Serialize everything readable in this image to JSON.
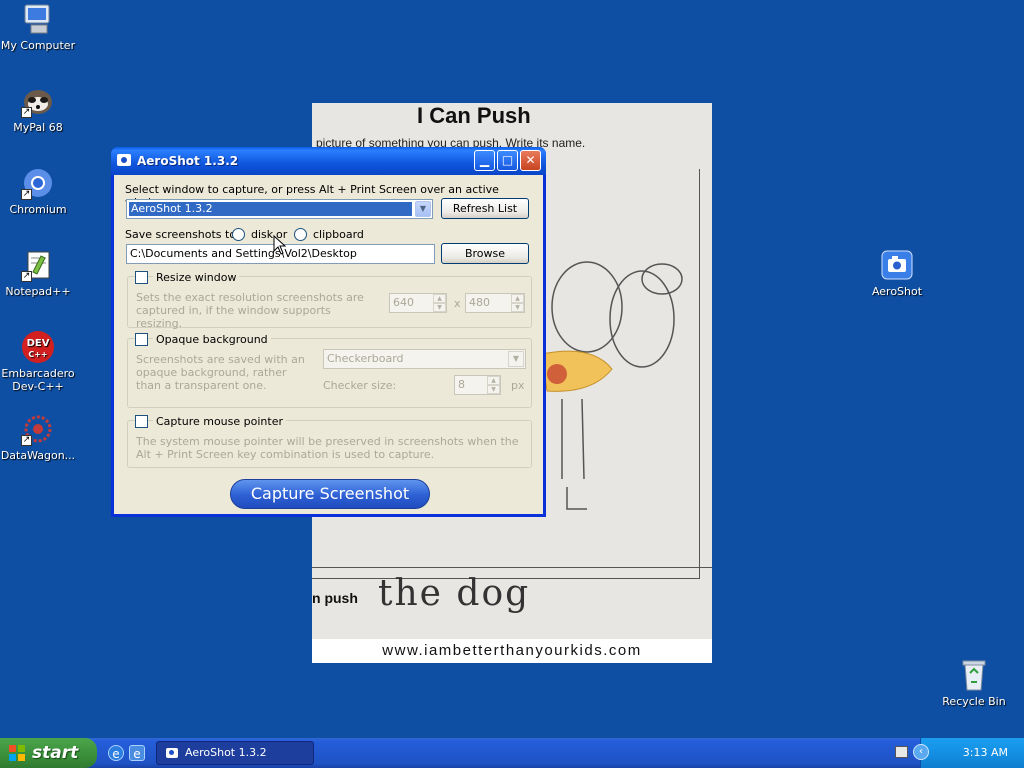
{
  "desktop": {
    "icons": [
      {
        "label": "My Computer",
        "icon": "my-computer-icon"
      },
      {
        "label": "MyPal 68",
        "icon": "mypal-icon"
      },
      {
        "label": "Chromium",
        "icon": "chromium-icon"
      },
      {
        "label": "Notepad++",
        "icon": "notepad-plus-plus-icon"
      },
      {
        "label": "Embarcadero Dev-C++",
        "icon": "dev-cpp-icon"
      },
      {
        "label": "DataWagon...",
        "icon": "datawagon-icon"
      },
      {
        "label": "AeroShot",
        "icon": "aeroshot-icon"
      },
      {
        "label": "Recycle Bin",
        "icon": "recycle-bin-icon"
      }
    ],
    "devcpp_logo_text": "DEV",
    "devcpp_logo_sub": "C++"
  },
  "photo": {
    "title": "I Can Push",
    "subtitle": "picture of something you can push. Write its name.",
    "push_label": "n push",
    "handwriting": "the dog",
    "footer": "www.iambetterthanyourkids.com"
  },
  "window": {
    "title": "AeroShot 1.3.2",
    "select_prompt": "Select window to capture, or press Alt + Print Screen over an active window.",
    "window_select_value": "AeroShot 1.3.2",
    "refresh_label": "Refresh List",
    "save_label": "Save screenshots to",
    "disk_label": "disk",
    "or_label": "or",
    "clipboard_label": "clipboard",
    "path_value": "C:\\Documents and Settings\\Vol2\\Desktop",
    "browse_label": "Browse",
    "resize": {
      "label": "Resize window",
      "desc": "Sets the exact resolution screenshots are captured in, if the window supports resizing.",
      "width": "640",
      "x": "x",
      "height": "480"
    },
    "opaque": {
      "label": "Opaque background",
      "desc": "Screenshots are saved with an opaque background, rather than a transparent one.",
      "mode": "Checkerboard",
      "checker_label": "Checker size:",
      "checker_value": "8",
      "unit": "px"
    },
    "mouse": {
      "label": "Capture mouse pointer",
      "desc": "The system mouse pointer will be preserved in screenshots when the Alt + Print Screen key combination is used to capture."
    },
    "capture_label": "Capture Screenshot"
  },
  "taskbar": {
    "start_label": "start",
    "task_label": "AeroShot 1.3.2",
    "clock": "3:13 AM"
  }
}
